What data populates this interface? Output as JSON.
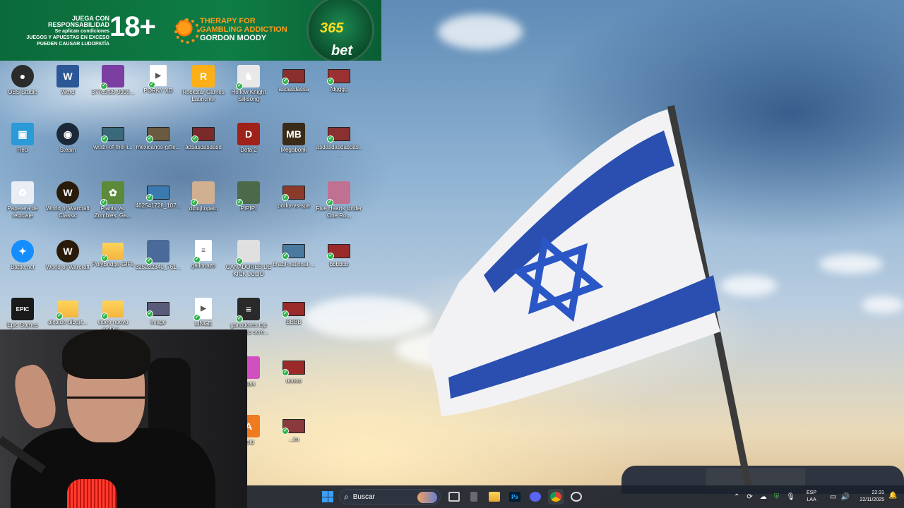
{
  "banner": {
    "line1": "JUEGA CON RESPONSABILIDAD",
    "line2": "Se aplican condiciones",
    "line3": "JUEGOS Y APUESTAS EN EXCESO",
    "line4": "PUEDEN CAUSAR LUDOPATÍA",
    "age": "18+",
    "therapy": "THERAPY FOR GAMBLING ADDICTION",
    "gordon": "GORDON MOODY",
    "brand": "bet",
    "brand_num": "365"
  },
  "desktop_icons": [
    {
      "label": "OBS Studio",
      "icon": "obs-icon",
      "color": "#2b2b2b",
      "glyph": "●"
    },
    {
      "label": "Word",
      "icon": "word-icon",
      "color": "#2b5797",
      "glyph": "W"
    },
    {
      "label": "377e5f05-9995...",
      "icon": "image-file-icon",
      "color": "#7a3fa0",
      "glyph": ""
    },
    {
      "label": "PORKY XD",
      "icon": "video-file-icon",
      "color": "#ffffff",
      "glyph": "▶"
    },
    {
      "label": "Rockstar Games Launcher",
      "icon": "rockstar-icon",
      "color": "#fcaf17",
      "glyph": "R"
    },
    {
      "label": "Hollow Knight Silksong",
      "icon": "hollow-knight-icon",
      "color": "#e8e8e8",
      "glyph": "♞"
    },
    {
      "label": "asdasdassa",
      "icon": "thumbnail-icon",
      "color": "#8a2e2e",
      "glyph": ""
    },
    {
      "label": "fdgggg",
      "icon": "thumbnail-icon",
      "color": "#9a3030",
      "glyph": ""
    },
    {
      "label": "Red",
      "icon": "network-icon",
      "color": "#2a9ad8",
      "glyph": "▣"
    },
    {
      "label": "Steam",
      "icon": "steam-icon",
      "color": "#1b2838",
      "glyph": "◉"
    },
    {
      "label": "wrath-of-the-li...",
      "icon": "thumbnail-icon",
      "color": "#3a6a7a",
      "glyph": ""
    },
    {
      "label": "mexicanos-gifte...",
      "icon": "thumbnail-icon",
      "color": "#6a5a40",
      "glyph": ""
    },
    {
      "label": "adsasdasdasd",
      "icon": "thumbnail-icon",
      "color": "#7a2a2a",
      "glyph": ""
    },
    {
      "label": "Dota 2",
      "icon": "dota-icon",
      "color": "#a0201a",
      "glyph": "D"
    },
    {
      "label": "Megabonk",
      "icon": "megabonk-icon",
      "color": "#3a2a18",
      "glyph": "MB"
    },
    {
      "label": "asdasdasdasdas...",
      "icon": "thumbnail-icon",
      "color": "#8a3030",
      "glyph": ""
    },
    {
      "label": "Papelera de reciclaje",
      "icon": "recycle-bin-icon",
      "color": "#e8eef4",
      "glyph": "♻"
    },
    {
      "label": "World of Warcraft Classic",
      "icon": "wow-classic-icon",
      "color": "#2a1a0a",
      "glyph": "W"
    },
    {
      "label": "Plants vs. Zombies: Ga...",
      "icon": "pvz-icon",
      "color": "#5a8a3a",
      "glyph": "✿"
    },
    {
      "label": "462541728_107...",
      "icon": "thumbnail-icon",
      "color": "#3a7ab0",
      "glyph": ""
    },
    {
      "label": "dibujitopalo",
      "icon": "image-file-icon",
      "color": "#d0b090",
      "glyph": ""
    },
    {
      "label": "PIPIPI",
      "icon": "image-file-icon",
      "color": "#4a6a4a",
      "glyph": ""
    },
    {
      "label": "porky-vs-spa",
      "icon": "thumbnail-icon",
      "color": "#8a3a2a",
      "glyph": ""
    },
    {
      "label": "Five Hearts Under One Ro...",
      "icon": "game-icon",
      "color": "#c07090",
      "glyph": ""
    },
    {
      "label": "Battle.net",
      "icon": "battlenet-icon",
      "color": "#148eff",
      "glyph": "✦"
    },
    {
      "label": "World of Warcraft",
      "icon": "wow-icon",
      "color": "#2a1a0a",
      "glyph": "W"
    },
    {
      "label": "PolyBridge-GIFs",
      "icon": "folder-icon",
      "color": "#f4c03f",
      "glyph": ""
    },
    {
      "label": "325232340_761...",
      "icon": "image-file-icon",
      "color": "#4a6a9a",
      "glyph": ""
    },
    {
      "label": "gallonazo",
      "icon": "document-icon",
      "color": "#ffffff",
      "glyph": "≡"
    },
    {
      "label": "GANADORES DE KICK JULIO",
      "icon": "image-file-icon",
      "color": "#e0e0e0",
      "glyph": ""
    },
    {
      "label": "brazil-national-...",
      "icon": "thumbnail-icon",
      "color": "#4a7aa0",
      "glyph": ""
    },
    {
      "label": "bbbbbb",
      "icon": "thumbnail-icon",
      "color": "#9a2a2a",
      "glyph": ""
    },
    {
      "label": "Epic Games Launcher",
      "icon": "epic-games-icon",
      "color": "#1a1a1a",
      "glyph": "EPIC"
    },
    {
      "label": "alcalde-dibujit...",
      "icon": "folder-icon",
      "color": "#f4c03f",
      "glyph": ""
    },
    {
      "label": "video nuevo wolfmi...",
      "icon": "folder-icon",
      "color": "#f4c03f",
      "glyph": ""
    },
    {
      "label": "image",
      "icon": "thumbnail-icon",
      "color": "#5a5a7a",
      "glyph": ""
    },
    {
      "label": "LINGE",
      "icon": "video-file-icon",
      "color": "#ffffff",
      "glyph": "▶"
    },
    {
      "label": "ganadores top apuestas sem...",
      "icon": "image-file-icon",
      "color": "#2a2a2a",
      "glyph": "≡"
    },
    {
      "label": "BBBB",
      "icon": "thumbnail-icon",
      "color": "#9a2a2a",
      "glyph": ""
    },
    {
      "label": "Guys",
      "icon": "fall-guys-icon",
      "color": "#d050c0",
      "glyph": ""
    },
    {
      "label": "ooooo",
      "icon": "thumbnail-icon",
      "color": "#9a2a2a",
      "glyph": ""
    },
    {
      "label": "bold",
      "icon": "app-icon",
      "color": "#f07a20",
      "glyph": "A"
    },
    {
      "label": "..,im",
      "icon": "thumbnail-icon",
      "color": "#8a3a3a",
      "glyph": ""
    }
  ],
  "taskbar": {
    "search_placeholder": "Buscar",
    "apps": [
      "file-explorer-icon",
      "photoshop-icon",
      "discord-icon",
      "chrome-icon",
      "steam-icon"
    ],
    "lang_top": "ESP",
    "lang_bottom": "LAA",
    "time": "22:31",
    "date": "22/11/2025"
  }
}
